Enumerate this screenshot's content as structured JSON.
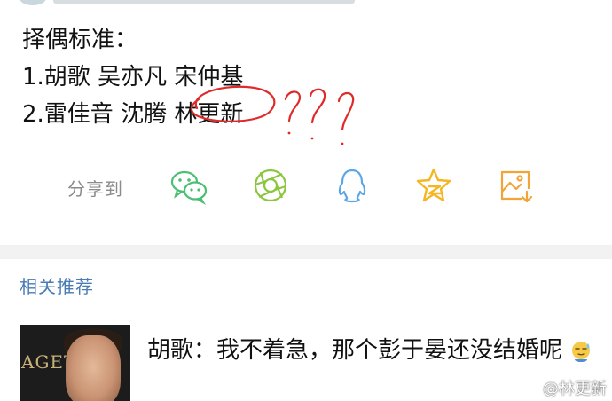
{
  "post": {
    "line1": "择偶标准：",
    "line2": "1.胡歌 吴亦凡 宋仲基",
    "line3_prefix": "2.雷佳音 沈腾 ",
    "line3_circled": "林更新"
  },
  "share": {
    "label": "分享到",
    "icons": [
      "wechat-icon",
      "moments-icon",
      "qq-icon",
      "qzone-icon",
      "save-image-icon"
    ],
    "colors": {
      "wechat": "#4bbf73",
      "moments": "#8cc63f",
      "qq": "#5aa7e8",
      "qzone": "#f5b623",
      "save": "#f2a43a"
    }
  },
  "recommend": {
    "header": "相关推荐",
    "items": [
      {
        "title": "胡歌：我不着急，那个彭于晏还没结婚呢",
        "thumb_text": "AGET"
      }
    ]
  },
  "watermark": {
    "text": "@林更新"
  },
  "colors": {
    "link_blue": "#4a7bb5",
    "annotation_red": "#e02a2a",
    "separator": "#f2f2f2"
  }
}
